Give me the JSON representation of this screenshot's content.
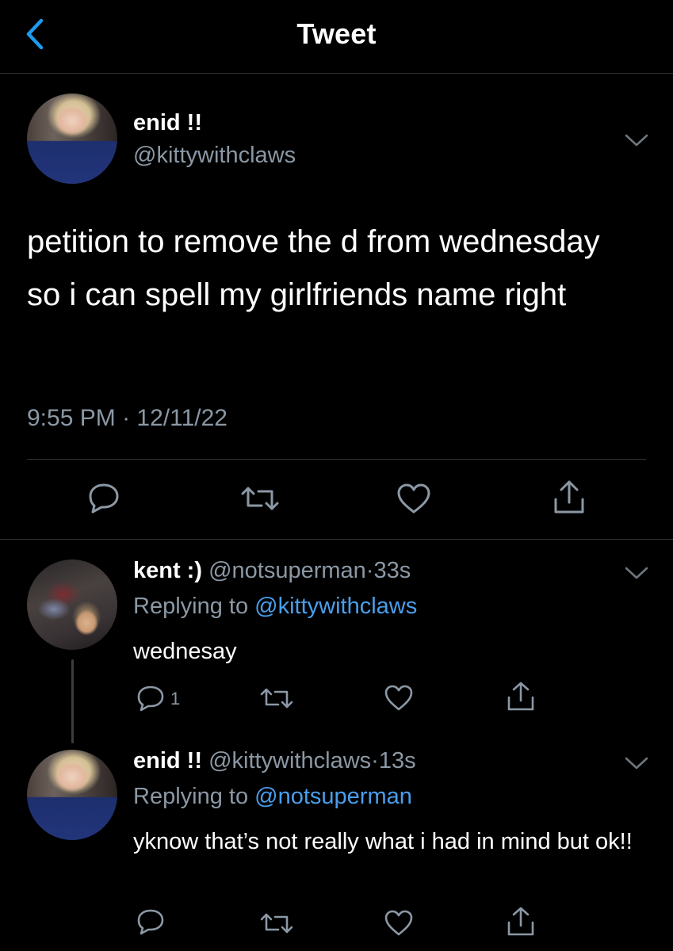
{
  "header": {
    "title": "Tweet"
  },
  "main_tweet": {
    "author_name": "enid !!",
    "author_handle": "@kittywithclaws",
    "text": "petition to remove the d from wednesday so i can spell my girlfriends name right",
    "time": "9:55 PM",
    "separator": "·",
    "date": "12/11/22"
  },
  "replies": [
    {
      "author_name": "kent :)",
      "author_handle": "@notsuperman",
      "separator": "·",
      "age": "33s",
      "replying_prefix": "Replying to",
      "replying_to": "@kittywithclaws",
      "text": "wednesay",
      "reply_count": "1"
    },
    {
      "author_name": "enid !!",
      "author_handle": "@kittywithclaws",
      "separator": "·",
      "age": "13s",
      "replying_prefix": "Replying to",
      "replying_to": "@notsuperman",
      "text": "yknow that’s not really what i had in mind but ok!!"
    }
  ],
  "icons": {
    "back": "chevron-left-icon",
    "more": "chevron-down-icon",
    "reply": "speech-bubble-icon",
    "retweet": "retweet-icon",
    "like": "heart-icon",
    "share": "share-icon"
  },
  "colors": {
    "background": "#000000",
    "accent": "#1d9bf0",
    "link": "#4a9eeb",
    "secondary_text": "#8b98a5",
    "divider": "#2f3336"
  }
}
